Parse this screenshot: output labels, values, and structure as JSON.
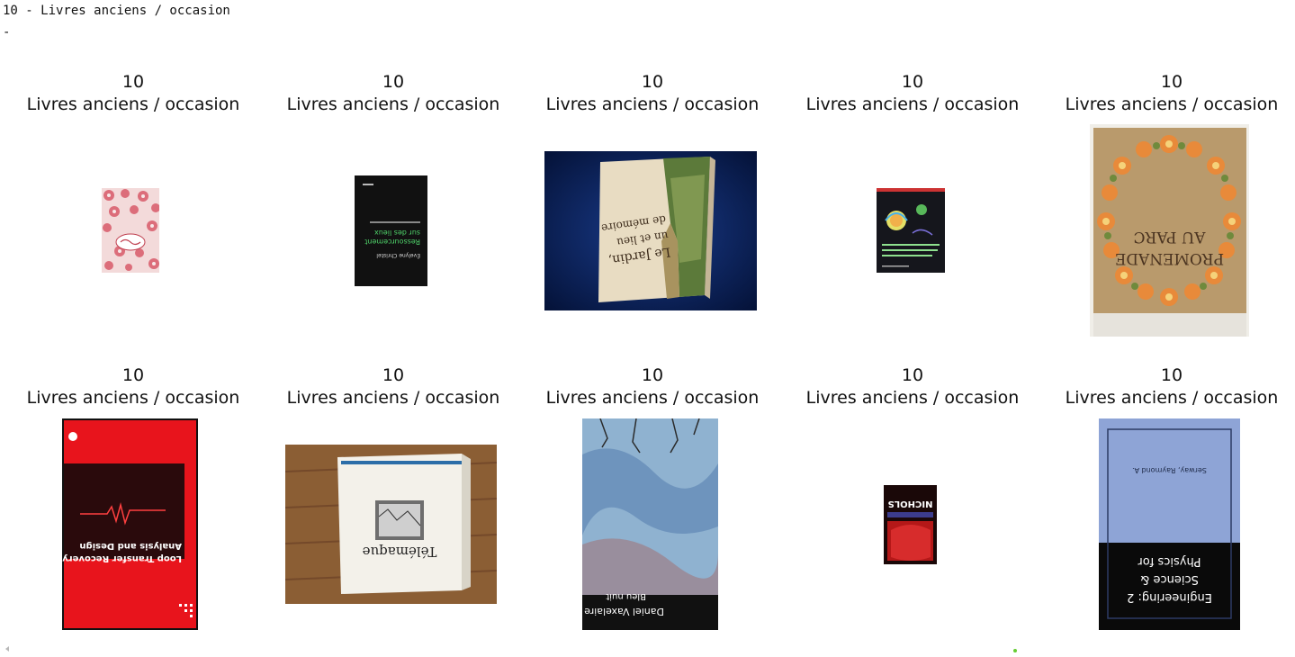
{
  "output": {
    "header": "10 - Livres anciens / occasion",
    "separator": "-"
  },
  "grid": {
    "items": [
      {
        "category_id": "10",
        "category_name": "Livres anciens / occasion",
        "cover": "book-cover-pink-roses-icon"
      },
      {
        "category_id": "10",
        "category_name": "Livres anciens / occasion",
        "cover": "book-cover-black-green-text-icon"
      },
      {
        "category_id": "10",
        "category_name": "Livres anciens / occasion",
        "cover": "book-cover-la-jardin-photo-icon"
      },
      {
        "category_id": "10",
        "category_name": "Livres anciens / occasion",
        "cover": "book-cover-dark-illustrated-icon"
      },
      {
        "category_id": "10",
        "category_name": "Livres anciens / occasion",
        "cover": "book-cover-promenade-au-parc-icon"
      },
      {
        "category_id": "10",
        "category_name": "Livres anciens / occasion",
        "cover": "book-cover-red-analysis-design-icon"
      },
      {
        "category_id": "10",
        "category_name": "Livres anciens / occasion",
        "cover": "book-cover-telemaque-photo-icon"
      },
      {
        "category_id": "10",
        "category_name": "Livres anciens / occasion",
        "cover": "book-cover-blue-illustrated-icon"
      },
      {
        "category_id": "10",
        "category_name": "Livres anciens / occasion",
        "cover": "book-cover-nichols-red-icon"
      },
      {
        "category_id": "10",
        "category_name": "Livres anciens / occasion",
        "cover": "book-cover-physics-science-engineering-icon"
      }
    ]
  },
  "covers_text": {
    "cover2_line1": "Évelyne Christel",
    "cover2_line2": "Ressourcement",
    "cover2_line3": "sur des lieux",
    "cover3_line1": "Le Jardin,",
    "cover3_line2": "un et lieu",
    "cover3_line3": "de mémoire",
    "cover5_line1": "PROMENADE",
    "cover5_line2": "AU PARC",
    "cover6_line1": "Loop Transfer Recovery:",
    "cover6_line2": "Analysis and Design",
    "cover7_line1": "Télémaque",
    "cover8_line1": "Bleu nuit",
    "cover8_line2": "Daniel Vaxelaire",
    "cover9_line1": "NICHOLS",
    "cover10_line1": "Physics for",
    "cover10_line2": "Science &",
    "cover10_line3": "Engineering: 2",
    "cover10_line4": "Serway, Raymond A."
  },
  "colors": {
    "background": "#ffffff",
    "text": "#111111",
    "scroll_arrow": "#b8b8b8",
    "status_dot": "#66cc33"
  }
}
